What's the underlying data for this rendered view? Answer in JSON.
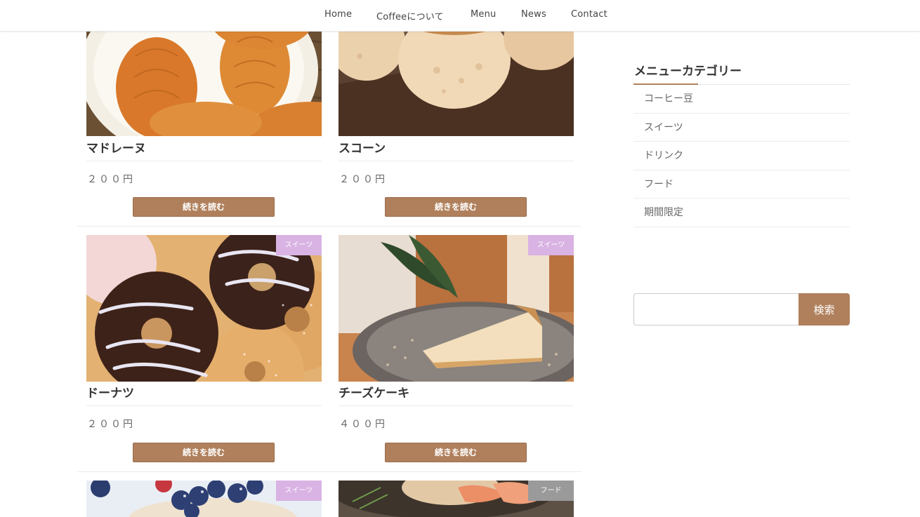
{
  "nav": {
    "items": [
      {
        "label": "Home"
      },
      {
        "label": "Coffeeについて"
      },
      {
        "label": "Menu"
      },
      {
        "label": "News"
      },
      {
        "label": "Contact"
      }
    ]
  },
  "products": [
    {
      "title": "マドレーヌ",
      "price": "２００円",
      "button": "続きを読む"
    },
    {
      "title": "スコーン",
      "price": "２００円",
      "button": "続きを読む"
    },
    {
      "title": "ドーナツ",
      "price": "２００円",
      "button": "続きを読む",
      "badge": "スイーツ"
    },
    {
      "title": "チーズケーキ",
      "price": "４００円",
      "button": "続きを読む",
      "badge": "スイーツ"
    },
    {
      "badge": "スイーツ"
    },
    {
      "badge": "フード"
    }
  ],
  "colors": {
    "accent": "#b0805c",
    "badge_sweets": "#d9b3e3",
    "badge_food": "#9a9a9a"
  },
  "sidebar": {
    "title": "メニューカテゴリー",
    "categories": [
      {
        "label": "コーヒー豆"
      },
      {
        "label": "スイーツ"
      },
      {
        "label": "ドリンク"
      },
      {
        "label": "フード"
      },
      {
        "label": "期間限定"
      }
    ],
    "search": {
      "placeholder": "",
      "button_label": "検索"
    }
  }
}
